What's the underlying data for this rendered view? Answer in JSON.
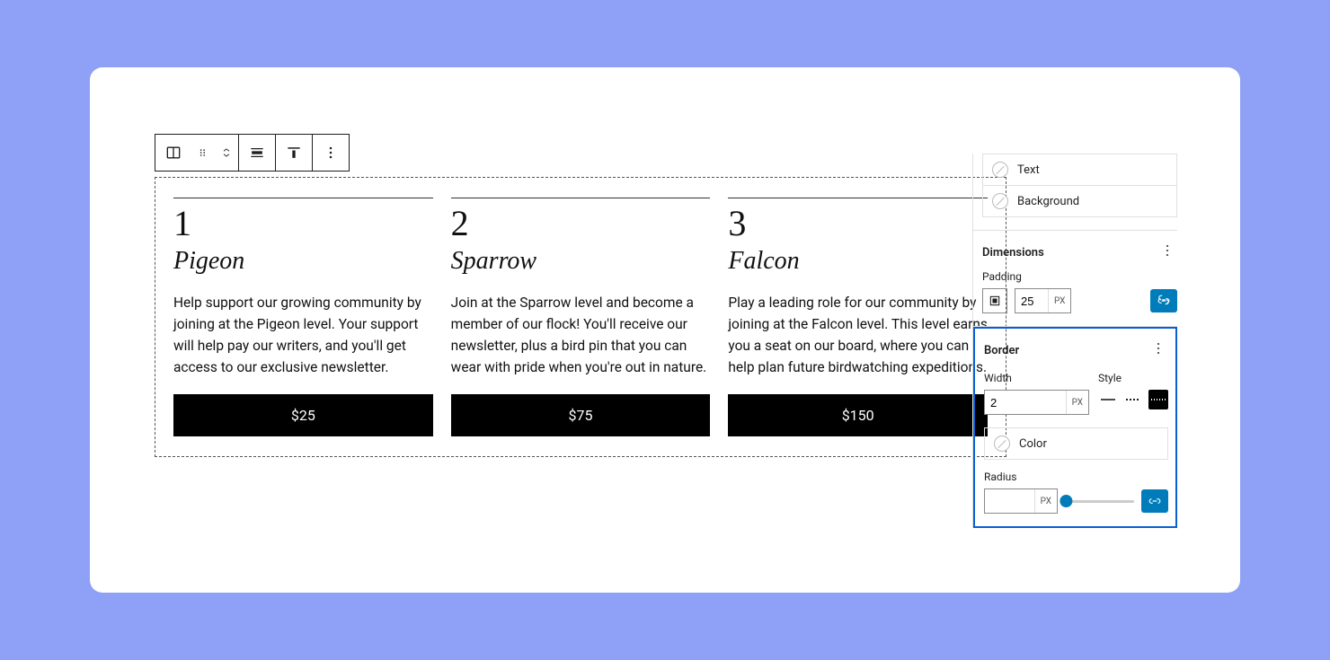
{
  "cards": [
    {
      "num": "1",
      "title": "Pigeon",
      "body": "Help support our growing community by joining at the Pigeon level. Your support will help pay our writers, and you'll get access to our exclusive newsletter.",
      "price": "$25"
    },
    {
      "num": "2",
      "title": "Sparrow",
      "body": "Join at the Sparrow level and become a member of our flock! You'll receive our newsletter, plus a bird pin that you can wear with pride when you're out in nature.",
      "price": "$75"
    },
    {
      "num": "3",
      "title": "Falcon",
      "body": "Play a leading role for our community by joining at the Falcon level. This level earns you a seat on our board, where you can help plan future birdwatching expeditions.",
      "price": "$150"
    }
  ],
  "sidebar": {
    "color": {
      "text_label": "Text",
      "background_label": "Background"
    },
    "dimensions": {
      "heading": "Dimensions",
      "padding_label": "Padding",
      "padding_value": "25",
      "padding_unit": "PX"
    },
    "border": {
      "heading": "Border",
      "width_label": "Width",
      "width_value": "2",
      "width_unit": "PX",
      "style_label": "Style",
      "color_label": "Color",
      "radius_label": "Radius",
      "radius_value": "",
      "radius_unit": "PX"
    }
  }
}
